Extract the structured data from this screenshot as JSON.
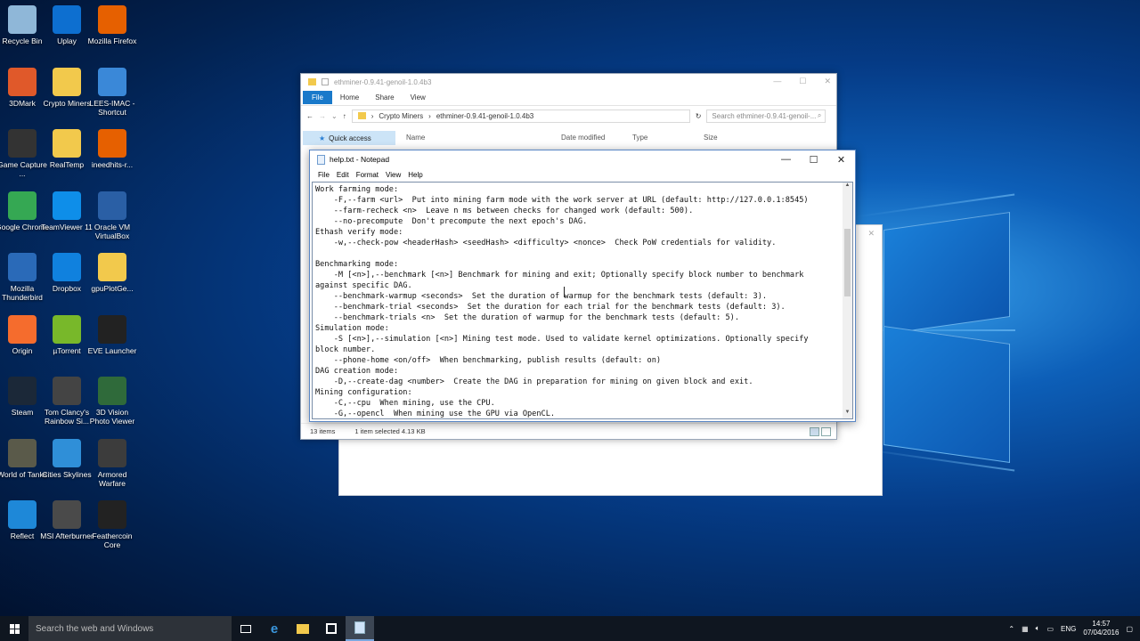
{
  "desktop_icons": [
    {
      "label": "Recycle Bin",
      "icon": "recycle-bin-icon",
      "color": "#8fb7d8"
    },
    {
      "label": "Uplay",
      "icon": "uplay-icon",
      "color": "#0d6fd0"
    },
    {
      "label": "Mozilla Firefox",
      "icon": "firefox-icon",
      "color": "#e66000"
    },
    {
      "label": "3DMark",
      "icon": "3dmark-icon",
      "color": "#e0592a"
    },
    {
      "label": "Crypto Miners",
      "icon": "folder-icon",
      "color": "#f2c94c"
    },
    {
      "label": "LEES-IMAC - Shortcut",
      "icon": "computer-icon",
      "color": "#3a88d8"
    },
    {
      "label": "Game Capture ...",
      "icon": "game-capture-icon",
      "color": "#333333"
    },
    {
      "label": "RealTemp",
      "icon": "folder-icon",
      "color": "#f2c94c"
    },
    {
      "label": "ineedhits-r...",
      "icon": "firefox-file-icon",
      "color": "#e66000"
    },
    {
      "label": "Google Chrome",
      "icon": "chrome-icon",
      "color": "#35a853"
    },
    {
      "label": "TeamViewer 11",
      "icon": "teamviewer-icon",
      "color": "#0e8ee9"
    },
    {
      "label": "Oracle VM VirtualBox",
      "icon": "virtualbox-icon",
      "color": "#2a5fa5"
    },
    {
      "label": "Mozilla Thunderbird",
      "icon": "thunderbird-icon",
      "color": "#2a6ab8"
    },
    {
      "label": "Dropbox",
      "icon": "dropbox-icon",
      "color": "#1081de"
    },
    {
      "label": "gpuPlotGe...",
      "icon": "folder-icon",
      "color": "#f2c94c"
    },
    {
      "label": "Origin",
      "icon": "origin-icon",
      "color": "#f56c2d"
    },
    {
      "label": "µTorrent",
      "icon": "utorrent-icon",
      "color": "#78b82a"
    },
    {
      "label": "EVE Launcher",
      "icon": "eve-icon",
      "color": "#222222"
    },
    {
      "label": "Steam",
      "icon": "steam-icon",
      "color": "#1b2838"
    },
    {
      "label": "Tom Clancy's Rainbow Si...",
      "icon": "rainbow-six-icon",
      "color": "#444444"
    },
    {
      "label": "3D Vision Photo Viewer",
      "icon": "3d-vision-icon",
      "color": "#2f6a3a"
    },
    {
      "label": "World of Tanks",
      "icon": "world-of-tanks-icon",
      "color": "#5a5a4a"
    },
    {
      "label": "Cities Skylines",
      "icon": "cities-skylines-icon",
      "color": "#2f8fd8"
    },
    {
      "label": "Armored Warfare",
      "icon": "armored-warfare-icon",
      "color": "#3c3c3c"
    },
    {
      "label": "Reflect",
      "icon": "reflect-icon",
      "color": "#1e88d8"
    },
    {
      "label": "MSI Afterburner",
      "icon": "msi-afterburner-icon",
      "color": "#4a4a4a"
    },
    {
      "label": "Feathercoin Core",
      "icon": "feathercoin-icon",
      "color": "#222222"
    }
  ],
  "explorer": {
    "title": "ethminer-0.9.41-genoil-1.0.4b3",
    "ribbon": {
      "file": "File",
      "home": "Home",
      "share": "Share",
      "view": "View"
    },
    "breadcrumb": [
      "Crypto Miners",
      "ethminer-0.9.41-genoil-1.0.4b3"
    ],
    "search_placeholder": "Search ethminer-0.9.41-genoil-...",
    "quick_access": "Quick access",
    "columns": {
      "name": "Name",
      "date": "Date modified",
      "type": "Type",
      "size": "Size"
    },
    "status_items": "13 items",
    "status_selected": "1 item selected  4.13 KB"
  },
  "notepad": {
    "title": "help.txt - Notepad",
    "menu": {
      "file": "File",
      "edit": "Edit",
      "format": "Format",
      "view": "View",
      "help": "Help"
    },
    "content": "Work farming mode:\n    -F,--farm <url>  Put into mining farm mode with the work server at URL (default: http://127.0.0.1:8545)\n    --farm-recheck <n>  Leave n ms between checks for changed work (default: 500).\n    --no-precompute  Don't precompute the next epoch's DAG.\nEthash verify mode:\n    -w,--check-pow <headerHash> <seedHash> <difficulty> <nonce>  Check PoW credentials for validity.\n\nBenchmarking mode:\n    -M [<n>],--benchmark [<n>] Benchmark for mining and exit; Optionally specify block number to benchmark\nagainst specific DAG.\n    --benchmark-warmup <seconds>  Set the duration of warmup for the benchmark tests (default: 3).\n    --benchmark-trial <seconds>  Set the duration for each trial for the benchmark tests (default: 3).\n    --benchmark-trials <n>  Set the duration of warmup for the benchmark tests (default: 5).\nSimulation mode:\n    -S [<n>],--simulation [<n>] Mining test mode. Used to validate kernel optimizations. Optionally specify\nblock number.\n    --phone-home <on/off>  When benchmarking, publish results (default: on)\nDAG creation mode:\n    -D,--create-dag <number>  Create the DAG in preparation for mining on given block and exit.\nMining configuration:\n    -C,--cpu  When mining, use the CPU.\n    -G,--opencl  When mining use the GPU via OpenCL."
  },
  "taskbar": {
    "search_placeholder": "Search the web and Windows",
    "language": "ENG",
    "time": "14:57",
    "date": "07/04/2016"
  }
}
